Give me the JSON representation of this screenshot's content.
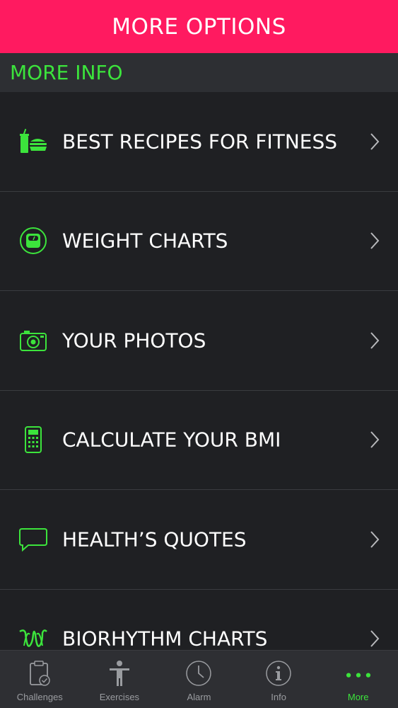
{
  "header": {
    "title": "MORE OPTIONS"
  },
  "section": {
    "title": "MORE INFO"
  },
  "colors": {
    "accent": "#3ce43c",
    "header_bg": "#ff1a60",
    "background": "#1f2023"
  },
  "items": [
    {
      "label": "BEST RECIPES FOR FITNESS",
      "icon": "food-icon"
    },
    {
      "label": "WEIGHT CHARTS",
      "icon": "scale-icon"
    },
    {
      "label": "YOUR PHOTOS",
      "icon": "camera-icon"
    },
    {
      "label": "CALCULATE YOUR BMI",
      "icon": "calculator-icon"
    },
    {
      "label": "HEALTH’S QUOTES",
      "icon": "speech-bubble-icon"
    },
    {
      "label": "BIORHYTHM CHARTS",
      "icon": "biorhythm-icon"
    }
  ],
  "tabs": [
    {
      "label": "Challenges",
      "icon": "clipboard-check-icon",
      "active": false
    },
    {
      "label": "Exercises",
      "icon": "person-icon",
      "active": false
    },
    {
      "label": "Alarm",
      "icon": "clock-icon",
      "active": false
    },
    {
      "label": "Info",
      "icon": "info-icon",
      "active": false
    },
    {
      "label": "More",
      "icon": "more-dots-icon",
      "active": true
    }
  ]
}
